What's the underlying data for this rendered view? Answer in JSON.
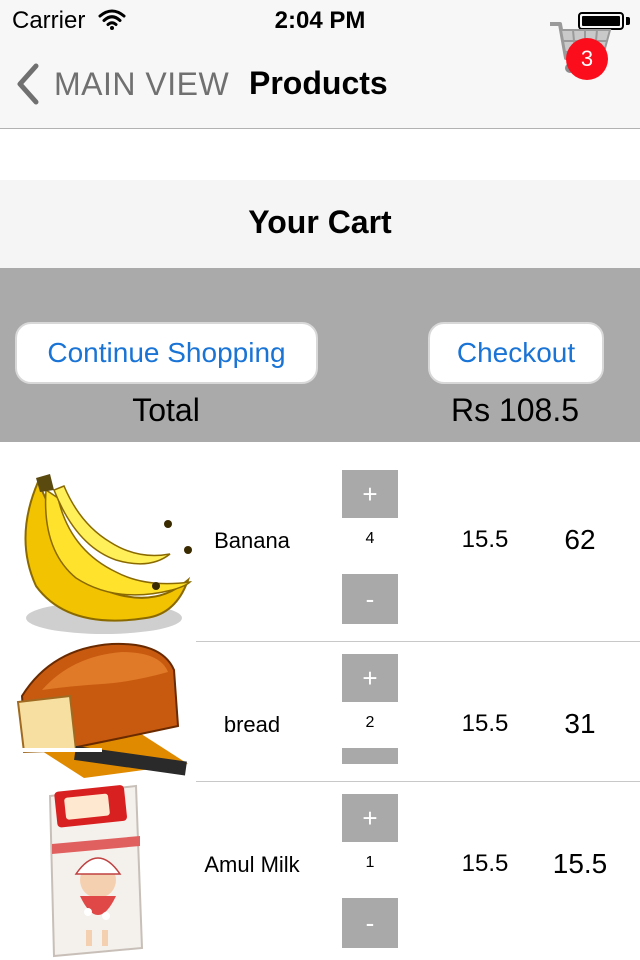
{
  "status_bar": {
    "carrier": "Carrier",
    "time": "2:04 PM"
  },
  "nav": {
    "back_label": "MAIN VIEW",
    "title": "Products",
    "cart_count": "3"
  },
  "cart": {
    "title": "Your Cart"
  },
  "summary": {
    "continue_label": "Continue Shopping",
    "checkout_label": "Checkout",
    "total_label": "Total",
    "total_value": "Rs 108.5"
  },
  "items": [
    {
      "name": "Banana",
      "quantity": "4",
      "price": "15.5",
      "total": "62",
      "image": "banana-image"
    },
    {
      "name": "bread",
      "quantity": "2",
      "price": "15.5",
      "total": "31",
      "image": "bread-image"
    },
    {
      "name": "Amul Milk",
      "quantity": "1",
      "price": "15.5",
      "total": "15.5",
      "image": "milk-carton-image"
    }
  ],
  "qty_controls": {
    "plus": "+",
    "minus": "-"
  },
  "colors": {
    "accent": "#1a74d6",
    "badge": "#fc0d1b",
    "summary_bg": "#aaaaaa",
    "qty_button": "#a9a9a9"
  }
}
